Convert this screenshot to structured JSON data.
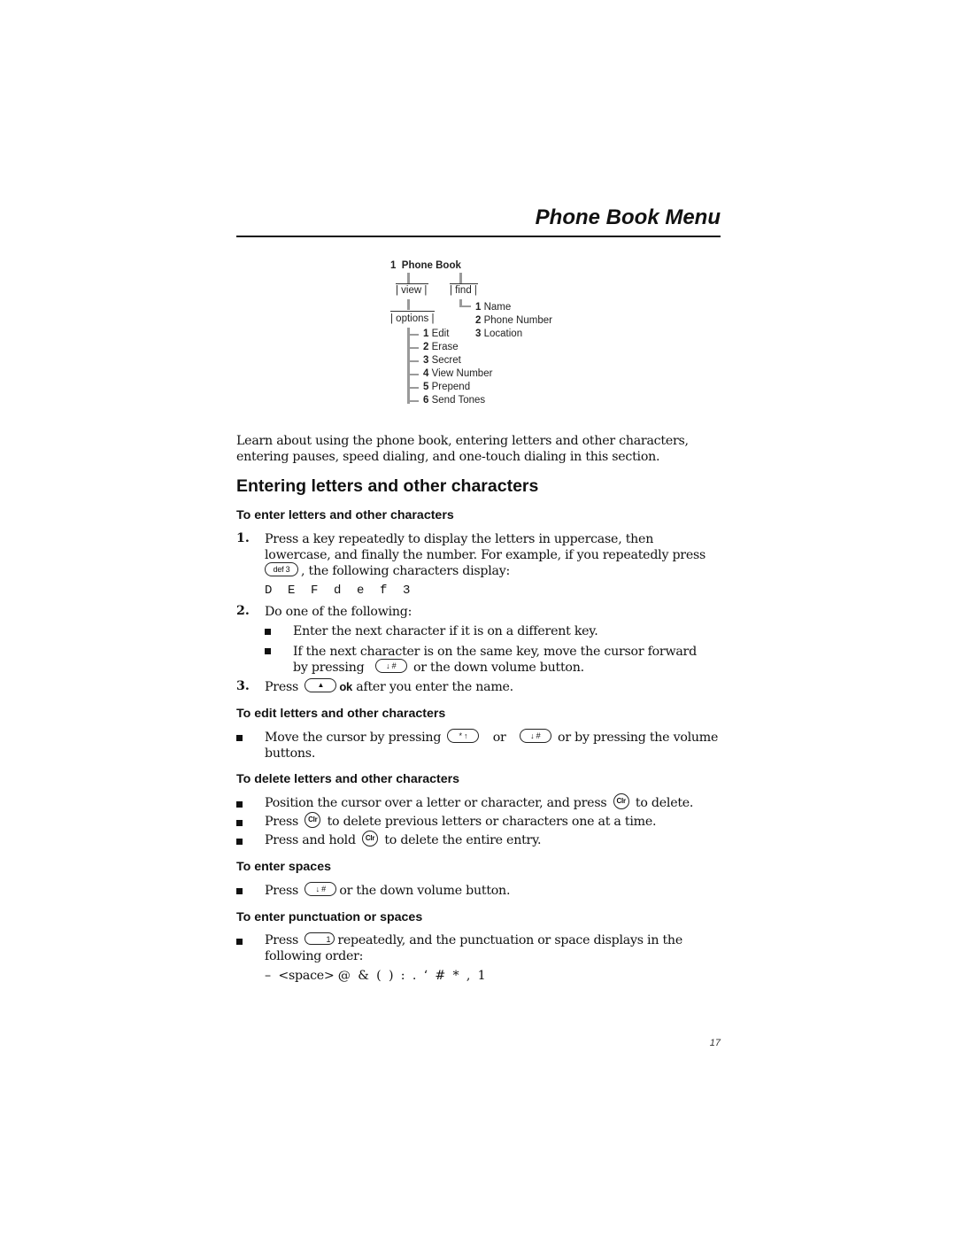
{
  "header": {
    "title": "Phone Book Menu"
  },
  "menu_diagram": {
    "root": {
      "number": "1",
      "label": "Phone Book"
    },
    "view": "| view |",
    "find": "| find |",
    "options": "| options |",
    "find_items": [
      {
        "number": "1",
        "label": "Name"
      },
      {
        "number": "2",
        "label": "Phone Number"
      },
      {
        "number": "3",
        "label": "Location"
      }
    ],
    "option_items": [
      {
        "number": "1",
        "label": "Edit"
      },
      {
        "number": "2",
        "label": "Erase"
      },
      {
        "number": "3",
        "label": "Secret"
      },
      {
        "number": "4",
        "label": "View Number"
      },
      {
        "number": "5",
        "label": "Prepend"
      },
      {
        "number": "6",
        "label": "Send Tones"
      }
    ]
  },
  "intro": {
    "line1": "Learn about using the phone book, entering letters and other characters,",
    "line2": "entering pauses, speed dialing, and one-touch dialing in this section."
  },
  "section": {
    "heading": "Entering letters and other characters"
  },
  "enter_letters": {
    "heading": "To enter letters and other characters",
    "step1_num": "1.",
    "step1_line1": "Press a key repeatedly to display the letters in uppercase, then",
    "step1_line2": "lowercase, and finally the number. For example, if you repeatedly press",
    "step1_line3": ", the following characters display:",
    "def_key": "def 3",
    "sequence": [
      "D",
      "E",
      "F",
      "d",
      "e",
      "f",
      "3"
    ],
    "step2_num": "2.",
    "step2_text": "Do one of the following:",
    "step2_bullet1": "Enter the next character if it is on a different key.",
    "step2_bullet2_line1": "If the next character is on the same key, move the cursor forward",
    "step2_bullet2_line2a": "by pressing",
    "step2_bullet2_line2b": "or the down volume button.",
    "step3_num": "3.",
    "step3_a": "Press",
    "step3_ok": "ok",
    "step3_b": "after you enter the name."
  },
  "keys": {
    "down_hash": "↓  #",
    "star_up": "*  ↑",
    "clr": "Clr",
    "one": "1",
    "up_arrow": "▲"
  },
  "edit_letters": {
    "heading": "To edit letters and other characters",
    "line1a": "Move the cursor by pressing",
    "line1_or": "or",
    "line1b": "or by pressing the volume",
    "line2": "buttons."
  },
  "delete_letters": {
    "heading": "To delete letters and other characters",
    "b1a": "Position the cursor over a letter or character, and press",
    "b1b": "to delete.",
    "b2a": "Press",
    "b2b": "to delete previous letters or characters one at a time.",
    "b3a": "Press and hold",
    "b3b": "to delete the entire entry."
  },
  "enter_spaces": {
    "heading": "To enter spaces",
    "b1a": "Press",
    "b1b": "or the down volume button."
  },
  "punctuation": {
    "heading": "To enter punctuation or spaces",
    "b1a": "Press",
    "b1b": "repeatedly, and the punctuation or space displays in the",
    "line2": "following order:",
    "order": "–  <space> @  &  (  )  :  .  ‘  #  *  ,  1"
  },
  "footer": {
    "page_number": "17"
  }
}
